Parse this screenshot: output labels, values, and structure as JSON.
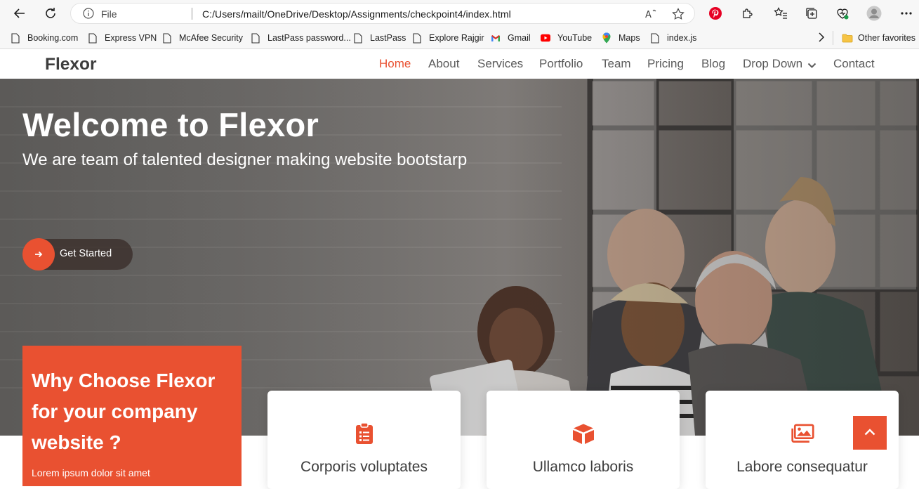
{
  "browser": {
    "address": {
      "scheme_label": "File",
      "url": "C:/Users/mailt/OneDrive/Desktop/Assignments/checkpoint4/index.html"
    },
    "bookmarks": [
      {
        "label": "Booking.com",
        "icon": "page-icon"
      },
      {
        "label": "Express VPN",
        "icon": "page-icon"
      },
      {
        "label": "McAfee Security",
        "icon": "page-icon"
      },
      {
        "label": "LastPass password...",
        "icon": "page-icon"
      },
      {
        "label": "LastPass",
        "icon": "page-icon"
      },
      {
        "label": "Explore Rajgir",
        "icon": "page-icon"
      },
      {
        "label": "Gmail",
        "icon": "gmail-icon"
      },
      {
        "label": "YouTube",
        "icon": "youtube-icon"
      },
      {
        "label": "Maps",
        "icon": "maps-icon"
      },
      {
        "label": "index.js",
        "icon": "page-icon"
      }
    ],
    "other_favorites": "Other favorites"
  },
  "site": {
    "logo": "Flexor",
    "menu": [
      "Home",
      "About",
      "Services",
      "Portfolio",
      "Team",
      "Pricing",
      "Blog",
      "Drop Down",
      "Contact"
    ],
    "active_menu": "Home",
    "hero": {
      "title": "Welcome to Flexor",
      "subtitle": "We are team of talented designer making website bootstarp",
      "cta": "Get Started"
    },
    "why": {
      "title": "Why Choose Flexor for your company website ?",
      "text": "Lorem ipsum dolor sit amet"
    },
    "cards": [
      {
        "title": "Corporis voluptates",
        "icon": "clipboard-list-icon"
      },
      {
        "title": "Ullamco laboris",
        "icon": "cube-icon"
      },
      {
        "title": "Labore consequatur",
        "icon": "images-icon"
      }
    ]
  },
  "colors": {
    "accent": "#e95131",
    "text_dark": "#3d3d3d",
    "menu_text": "#5a5a5a"
  }
}
